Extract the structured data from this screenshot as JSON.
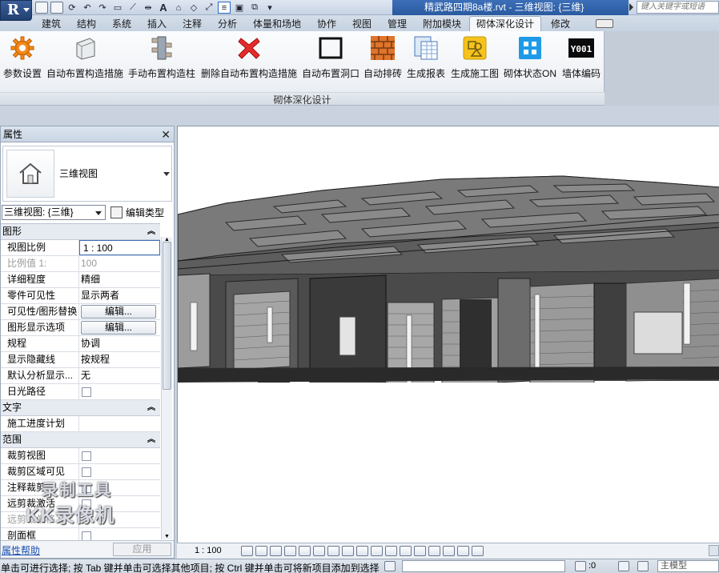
{
  "window": {
    "title": "精武路四期8a楼.rvt - 三维视图: {三维}",
    "search_placeholder": "键入关键字或短语"
  },
  "colors": {
    "title_blue": "#2a5aa0",
    "link_blue": "#1a4fb0",
    "selected_border": "#3d6fb5"
  },
  "ribbon": {
    "tabs": [
      "建筑",
      "结构",
      "系统",
      "插入",
      "注释",
      "分析",
      "体量和场地",
      "协作",
      "视图",
      "管理",
      "附加模块",
      "砌体深化设计",
      "修改"
    ],
    "active_tab": "砌体深化设计",
    "panel_title": "砌体深化设计",
    "buttons": [
      {
        "label": "参数设置",
        "icon": "gear-icon"
      },
      {
        "label": "自动布置构造措施",
        "icon": "block-icon"
      },
      {
        "label": "手动布置构造柱",
        "icon": "column-icon"
      },
      {
        "label": "删除自动布置构造措施",
        "icon": "red-x-icon"
      },
      {
        "label": "自动布置洞口",
        "icon": "opening-icon"
      },
      {
        "label": "自动排砖",
        "icon": "brick-icon"
      },
      {
        "label": "生成报表",
        "icon": "report-icon"
      },
      {
        "label": "生成施工图",
        "icon": "drawing-icon"
      },
      {
        "label": "砌体状态ON",
        "icon": "grid-status-icon"
      },
      {
        "label": "墙体编码",
        "icon": "code-icon"
      }
    ],
    "code_icon_text": "Y001"
  },
  "properties": {
    "header": "属性",
    "type_name": "三维视图",
    "view_selector": "三维视图: {三维}",
    "edit_type": "编辑类型",
    "groups": [
      {
        "name": "图形",
        "rows": [
          {
            "key": "视图比例",
            "value": "1 : 100",
            "style": "box"
          },
          {
            "key": "比例值 1:",
            "value": "100",
            "style": "dim"
          },
          {
            "key": "详细程度",
            "value": "精细"
          },
          {
            "key": "零件可见性",
            "value": "显示两者"
          },
          {
            "key": "可见性/图形替换",
            "value": "编辑...",
            "style": "button"
          },
          {
            "key": "图形显示选项",
            "value": "编辑...",
            "style": "button"
          },
          {
            "key": "规程",
            "value": "协调"
          },
          {
            "key": "显示隐藏线",
            "value": "按规程"
          },
          {
            "key": "默认分析显示...",
            "value": "无"
          },
          {
            "key": "日光路径",
            "value": "",
            "style": "checkbox"
          }
        ]
      },
      {
        "name": "文字",
        "rows": [
          {
            "key": "施工进度计划",
            "value": ""
          }
        ]
      },
      {
        "name": "范围",
        "rows": [
          {
            "key": "裁剪视图",
            "value": "",
            "style": "checkbox"
          },
          {
            "key": "裁剪区域可见",
            "value": "",
            "style": "checkbox"
          },
          {
            "key": "注释裁剪",
            "value": "",
            "style": "checkbox"
          },
          {
            "key": "远剪裁激活",
            "value": "",
            "style": "checkbox"
          },
          {
            "key": "远剪裁偏移",
            "value": "",
            "style": "dim"
          },
          {
            "key": "剖面框",
            "value": "",
            "style": "checkbox"
          }
        ]
      }
    ],
    "help_link": "属性帮助",
    "apply": "应用"
  },
  "watermark": {
    "line1": "录制工具",
    "line2": "KK录像机"
  },
  "view_control": {
    "scale": "1 : 100"
  },
  "status": {
    "text": "单击可进行选择; 按 Tab 键并单击可选择其他项目; 按 Ctrl 键并单击可将新项目添加到选择",
    "count": ":0",
    "model": "主模型"
  }
}
